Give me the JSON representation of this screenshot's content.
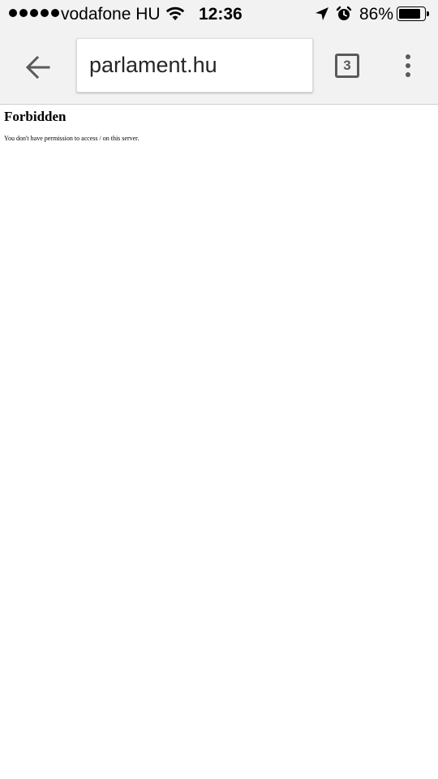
{
  "status_bar": {
    "carrier": "vodafone HU",
    "time": "12:36",
    "battery_percent": "86%",
    "battery_level": 0.86,
    "signal_bars": 5
  },
  "toolbar": {
    "url": "parlament.hu",
    "tab_count": "3"
  },
  "page": {
    "heading": "Forbidden",
    "message": "You don't have permission to access / on this server."
  },
  "colors": {
    "chrome_background": "#f2f2f2",
    "toolbar_icon": "#5a5a5a",
    "page_background": "#ffffff"
  },
  "icons": {
    "back": "arrow-left-icon",
    "tabs": "tab-switcher-icon",
    "menu": "more-vertical-icon",
    "wifi": "wifi-icon",
    "location": "location-arrow-icon",
    "alarm": "alarm-clock-icon",
    "battery": "battery-icon"
  }
}
